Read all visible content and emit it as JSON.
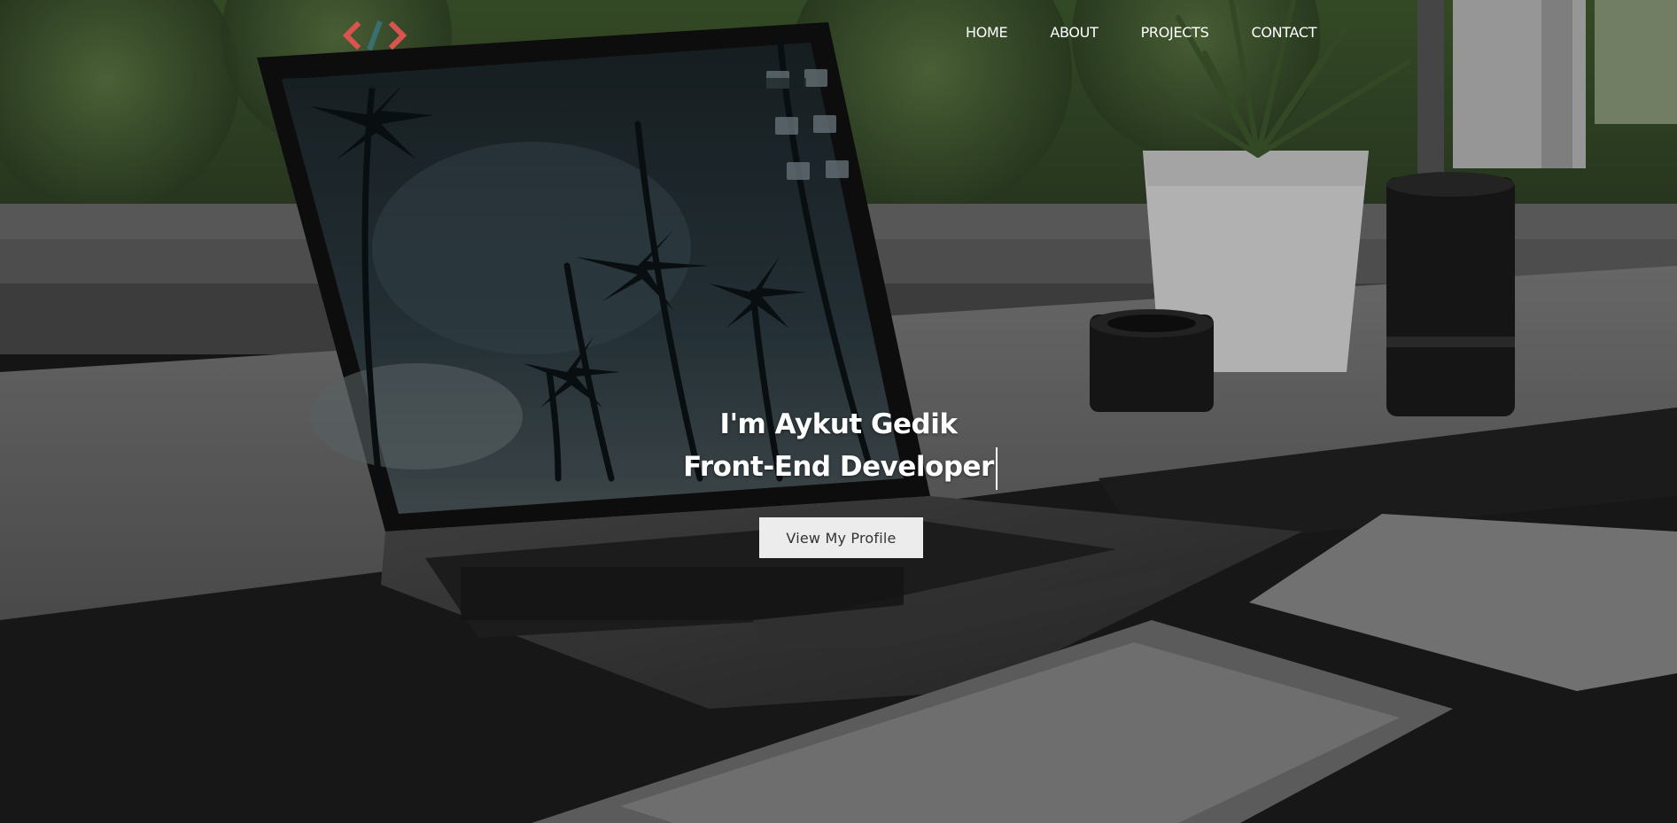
{
  "brand": {
    "logo_icon": "code-brackets-icon",
    "colors": {
      "bracket": "#d9534f",
      "slash": "#3a6f72"
    }
  },
  "nav": {
    "items": [
      {
        "label": "HOME"
      },
      {
        "label": "ABOUT"
      },
      {
        "label": "PROJECTS"
      },
      {
        "label": "CONTACT"
      }
    ]
  },
  "hero": {
    "greeting": "I'm Aykut Gedik",
    "role": "Front-End Developer",
    "cta_label": "View My Profile",
    "background_image": "laptop-desk-photo",
    "colors": {
      "text": "#ffffff",
      "button_bg": "#ececec",
      "button_text": "#333333"
    }
  }
}
